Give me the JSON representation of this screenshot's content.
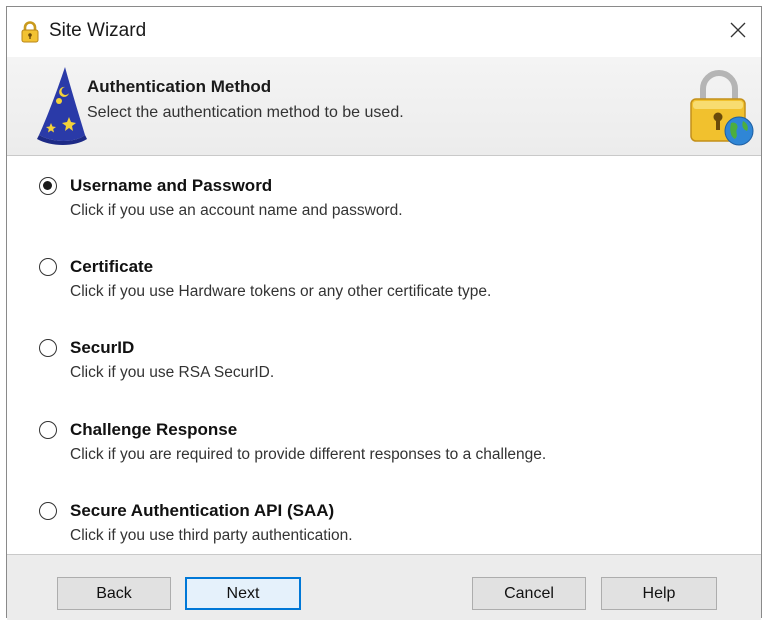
{
  "window": {
    "title": "Site Wizard",
    "title_icon": "padlock-icon",
    "close_icon": "close-icon"
  },
  "header": {
    "title": "Authentication Method",
    "subtitle": "Select the authentication method to be used.",
    "left_icon": "wizard-hat-icon",
    "right_icon": "lock-globe-icon"
  },
  "options": [
    {
      "label": "Username and Password",
      "description": "Click if you use an account name and password.",
      "selected": true
    },
    {
      "label": "Certificate",
      "description": "Click if you use Hardware tokens or any other certificate type.",
      "selected": false
    },
    {
      "label": "SecurID",
      "description": "Click if you use RSA SecurID.",
      "selected": false
    },
    {
      "label": "Challenge Response",
      "description": "Click if you are required to provide different responses to a challenge.",
      "selected": false
    },
    {
      "label": "Secure Authentication API (SAA)",
      "description": "Click if you use third party authentication.",
      "selected": false
    }
  ],
  "buttons": {
    "back": "Back",
    "next": "Next",
    "cancel": "Cancel",
    "help": "Help"
  },
  "colors": {
    "accent": "#0078d7",
    "header_bg": "#ececec",
    "footer_bg": "#ececec"
  }
}
